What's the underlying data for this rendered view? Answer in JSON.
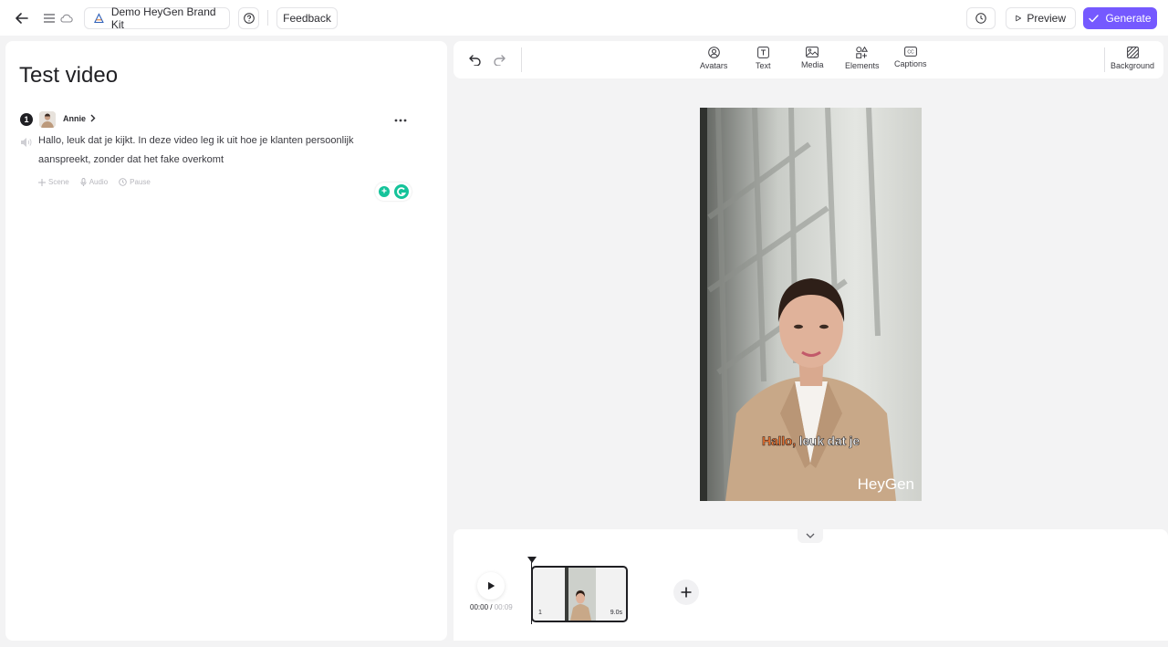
{
  "topbar": {
    "brand_kit": "Demo HeyGen Brand Kit",
    "feedback": "Feedback",
    "preview": "Preview",
    "generate": "Generate"
  },
  "script": {
    "title": "Test video",
    "scene_number": "1",
    "avatar_name": "Annie",
    "text": "Hallo, leuk dat je kijkt. In deze video leg ik uit hoe je klanten persoonlijk aanspreekt, zonder dat het fake overkomt",
    "actions": {
      "scene": "Scene",
      "audio": "Audio",
      "pause": "Pause"
    }
  },
  "toolbar": {
    "avatars": "Avatars",
    "text": "Text",
    "media": "Media",
    "elements": "Elements",
    "captions": "Captions",
    "background": "Background"
  },
  "canvas": {
    "caption_highlight": "Hallo,",
    "caption_rest": " leuk dat je",
    "watermark": "HeyGen"
  },
  "timeline": {
    "current_time": "00:00",
    "separator": " / ",
    "total_time": "00:09",
    "clip_number": "1",
    "clip_duration": "9.0s"
  },
  "colors": {
    "accent": "#7559ff",
    "caption_highlight": "#ff7a2f"
  }
}
